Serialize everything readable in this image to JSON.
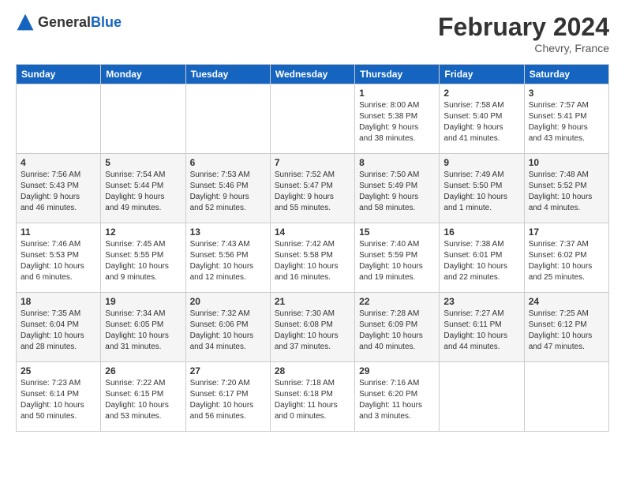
{
  "header": {
    "logo_general": "General",
    "logo_blue": "Blue",
    "month_year": "February 2024",
    "location": "Chevry, France"
  },
  "days_of_week": [
    "Sunday",
    "Monday",
    "Tuesday",
    "Wednesday",
    "Thursday",
    "Friday",
    "Saturday"
  ],
  "weeks": [
    [
      {
        "num": "",
        "info": ""
      },
      {
        "num": "",
        "info": ""
      },
      {
        "num": "",
        "info": ""
      },
      {
        "num": "",
        "info": ""
      },
      {
        "num": "1",
        "info": "Sunrise: 8:00 AM\nSunset: 5:38 PM\nDaylight: 9 hours\nand 38 minutes."
      },
      {
        "num": "2",
        "info": "Sunrise: 7:58 AM\nSunset: 5:40 PM\nDaylight: 9 hours\nand 41 minutes."
      },
      {
        "num": "3",
        "info": "Sunrise: 7:57 AM\nSunset: 5:41 PM\nDaylight: 9 hours\nand 43 minutes."
      }
    ],
    [
      {
        "num": "4",
        "info": "Sunrise: 7:56 AM\nSunset: 5:43 PM\nDaylight: 9 hours\nand 46 minutes."
      },
      {
        "num": "5",
        "info": "Sunrise: 7:54 AM\nSunset: 5:44 PM\nDaylight: 9 hours\nand 49 minutes."
      },
      {
        "num": "6",
        "info": "Sunrise: 7:53 AM\nSunset: 5:46 PM\nDaylight: 9 hours\nand 52 minutes."
      },
      {
        "num": "7",
        "info": "Sunrise: 7:52 AM\nSunset: 5:47 PM\nDaylight: 9 hours\nand 55 minutes."
      },
      {
        "num": "8",
        "info": "Sunrise: 7:50 AM\nSunset: 5:49 PM\nDaylight: 9 hours\nand 58 minutes."
      },
      {
        "num": "9",
        "info": "Sunrise: 7:49 AM\nSunset: 5:50 PM\nDaylight: 10 hours\nand 1 minute."
      },
      {
        "num": "10",
        "info": "Sunrise: 7:48 AM\nSunset: 5:52 PM\nDaylight: 10 hours\nand 4 minutes."
      }
    ],
    [
      {
        "num": "11",
        "info": "Sunrise: 7:46 AM\nSunset: 5:53 PM\nDaylight: 10 hours\nand 6 minutes."
      },
      {
        "num": "12",
        "info": "Sunrise: 7:45 AM\nSunset: 5:55 PM\nDaylight: 10 hours\nand 9 minutes."
      },
      {
        "num": "13",
        "info": "Sunrise: 7:43 AM\nSunset: 5:56 PM\nDaylight: 10 hours\nand 12 minutes."
      },
      {
        "num": "14",
        "info": "Sunrise: 7:42 AM\nSunset: 5:58 PM\nDaylight: 10 hours\nand 16 minutes."
      },
      {
        "num": "15",
        "info": "Sunrise: 7:40 AM\nSunset: 5:59 PM\nDaylight: 10 hours\nand 19 minutes."
      },
      {
        "num": "16",
        "info": "Sunrise: 7:38 AM\nSunset: 6:01 PM\nDaylight: 10 hours\nand 22 minutes."
      },
      {
        "num": "17",
        "info": "Sunrise: 7:37 AM\nSunset: 6:02 PM\nDaylight: 10 hours\nand 25 minutes."
      }
    ],
    [
      {
        "num": "18",
        "info": "Sunrise: 7:35 AM\nSunset: 6:04 PM\nDaylight: 10 hours\nand 28 minutes."
      },
      {
        "num": "19",
        "info": "Sunrise: 7:34 AM\nSunset: 6:05 PM\nDaylight: 10 hours\nand 31 minutes."
      },
      {
        "num": "20",
        "info": "Sunrise: 7:32 AM\nSunset: 6:06 PM\nDaylight: 10 hours\nand 34 minutes."
      },
      {
        "num": "21",
        "info": "Sunrise: 7:30 AM\nSunset: 6:08 PM\nDaylight: 10 hours\nand 37 minutes."
      },
      {
        "num": "22",
        "info": "Sunrise: 7:28 AM\nSunset: 6:09 PM\nDaylight: 10 hours\nand 40 minutes."
      },
      {
        "num": "23",
        "info": "Sunrise: 7:27 AM\nSunset: 6:11 PM\nDaylight: 10 hours\nand 44 minutes."
      },
      {
        "num": "24",
        "info": "Sunrise: 7:25 AM\nSunset: 6:12 PM\nDaylight: 10 hours\nand 47 minutes."
      }
    ],
    [
      {
        "num": "25",
        "info": "Sunrise: 7:23 AM\nSunset: 6:14 PM\nDaylight: 10 hours\nand 50 minutes."
      },
      {
        "num": "26",
        "info": "Sunrise: 7:22 AM\nSunset: 6:15 PM\nDaylight: 10 hours\nand 53 minutes."
      },
      {
        "num": "27",
        "info": "Sunrise: 7:20 AM\nSunset: 6:17 PM\nDaylight: 10 hours\nand 56 minutes."
      },
      {
        "num": "28",
        "info": "Sunrise: 7:18 AM\nSunset: 6:18 PM\nDaylight: 11 hours\nand 0 minutes."
      },
      {
        "num": "29",
        "info": "Sunrise: 7:16 AM\nSunset: 6:20 PM\nDaylight: 11 hours\nand 3 minutes."
      },
      {
        "num": "",
        "info": ""
      },
      {
        "num": "",
        "info": ""
      }
    ]
  ]
}
